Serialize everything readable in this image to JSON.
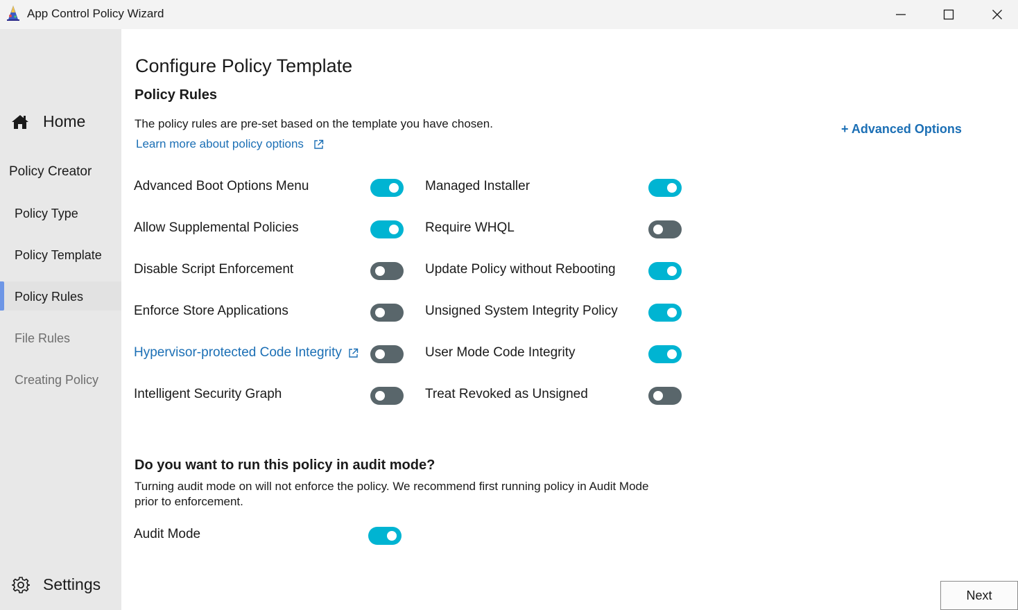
{
  "window": {
    "title": "App Control Policy Wizard"
  },
  "sidebar": {
    "home_label": "Home",
    "section_header": "Policy Creator",
    "items": [
      {
        "label": "Policy Type",
        "state": "enabled"
      },
      {
        "label": "Policy Template",
        "state": "enabled"
      },
      {
        "label": "Policy Rules",
        "state": "selected"
      },
      {
        "label": "File Rules",
        "state": "disabled"
      },
      {
        "label": "Creating Policy",
        "state": "disabled"
      }
    ],
    "settings_label": "Settings"
  },
  "main": {
    "page_title": "Configure Policy Template",
    "section_title": "Policy Rules",
    "description": "The policy rules are pre-set based on the template you have chosen.",
    "learn_more_link": "Learn more about policy options",
    "advanced_options": "+ Advanced Options",
    "rules_left": [
      {
        "label": "Advanced Boot Options Menu",
        "on": true
      },
      {
        "label": "Allow Supplemental Policies",
        "on": true
      },
      {
        "label": "Disable Script Enforcement",
        "on": false
      },
      {
        "label": "Enforce Store Applications",
        "on": false
      },
      {
        "label": "Hypervisor-protected Code Integrity",
        "on": false,
        "link": true
      },
      {
        "label": "Intelligent Security Graph",
        "on": false
      }
    ],
    "rules_right": [
      {
        "label": "Managed Installer",
        "on": true
      },
      {
        "label": "Require WHQL",
        "on": false
      },
      {
        "label": "Update Policy without Rebooting",
        "on": true
      },
      {
        "label": "Unsigned System Integrity Policy",
        "on": true
      },
      {
        "label": "User Mode Code Integrity",
        "on": true
      },
      {
        "label": "Treat Revoked as Unsigned",
        "on": false
      }
    ],
    "audit": {
      "title": "Do you want to run this policy in audit mode?",
      "description": "Turning audit mode on will not enforce the policy. We recommend first running policy in Audit Mode prior to enforcement.",
      "label": "Audit Mode",
      "on": true
    },
    "next_label": "Next"
  },
  "colors": {
    "accent_link": "#1b6fb5",
    "toggle_on": "#00b4d2",
    "toggle_off": "#59666b",
    "nav_indicator": "#6e96e6"
  },
  "icons": {
    "app": "app-wizard-icon",
    "home": "home-icon",
    "settings": "gear-icon",
    "external_link": "external-link-icon"
  }
}
